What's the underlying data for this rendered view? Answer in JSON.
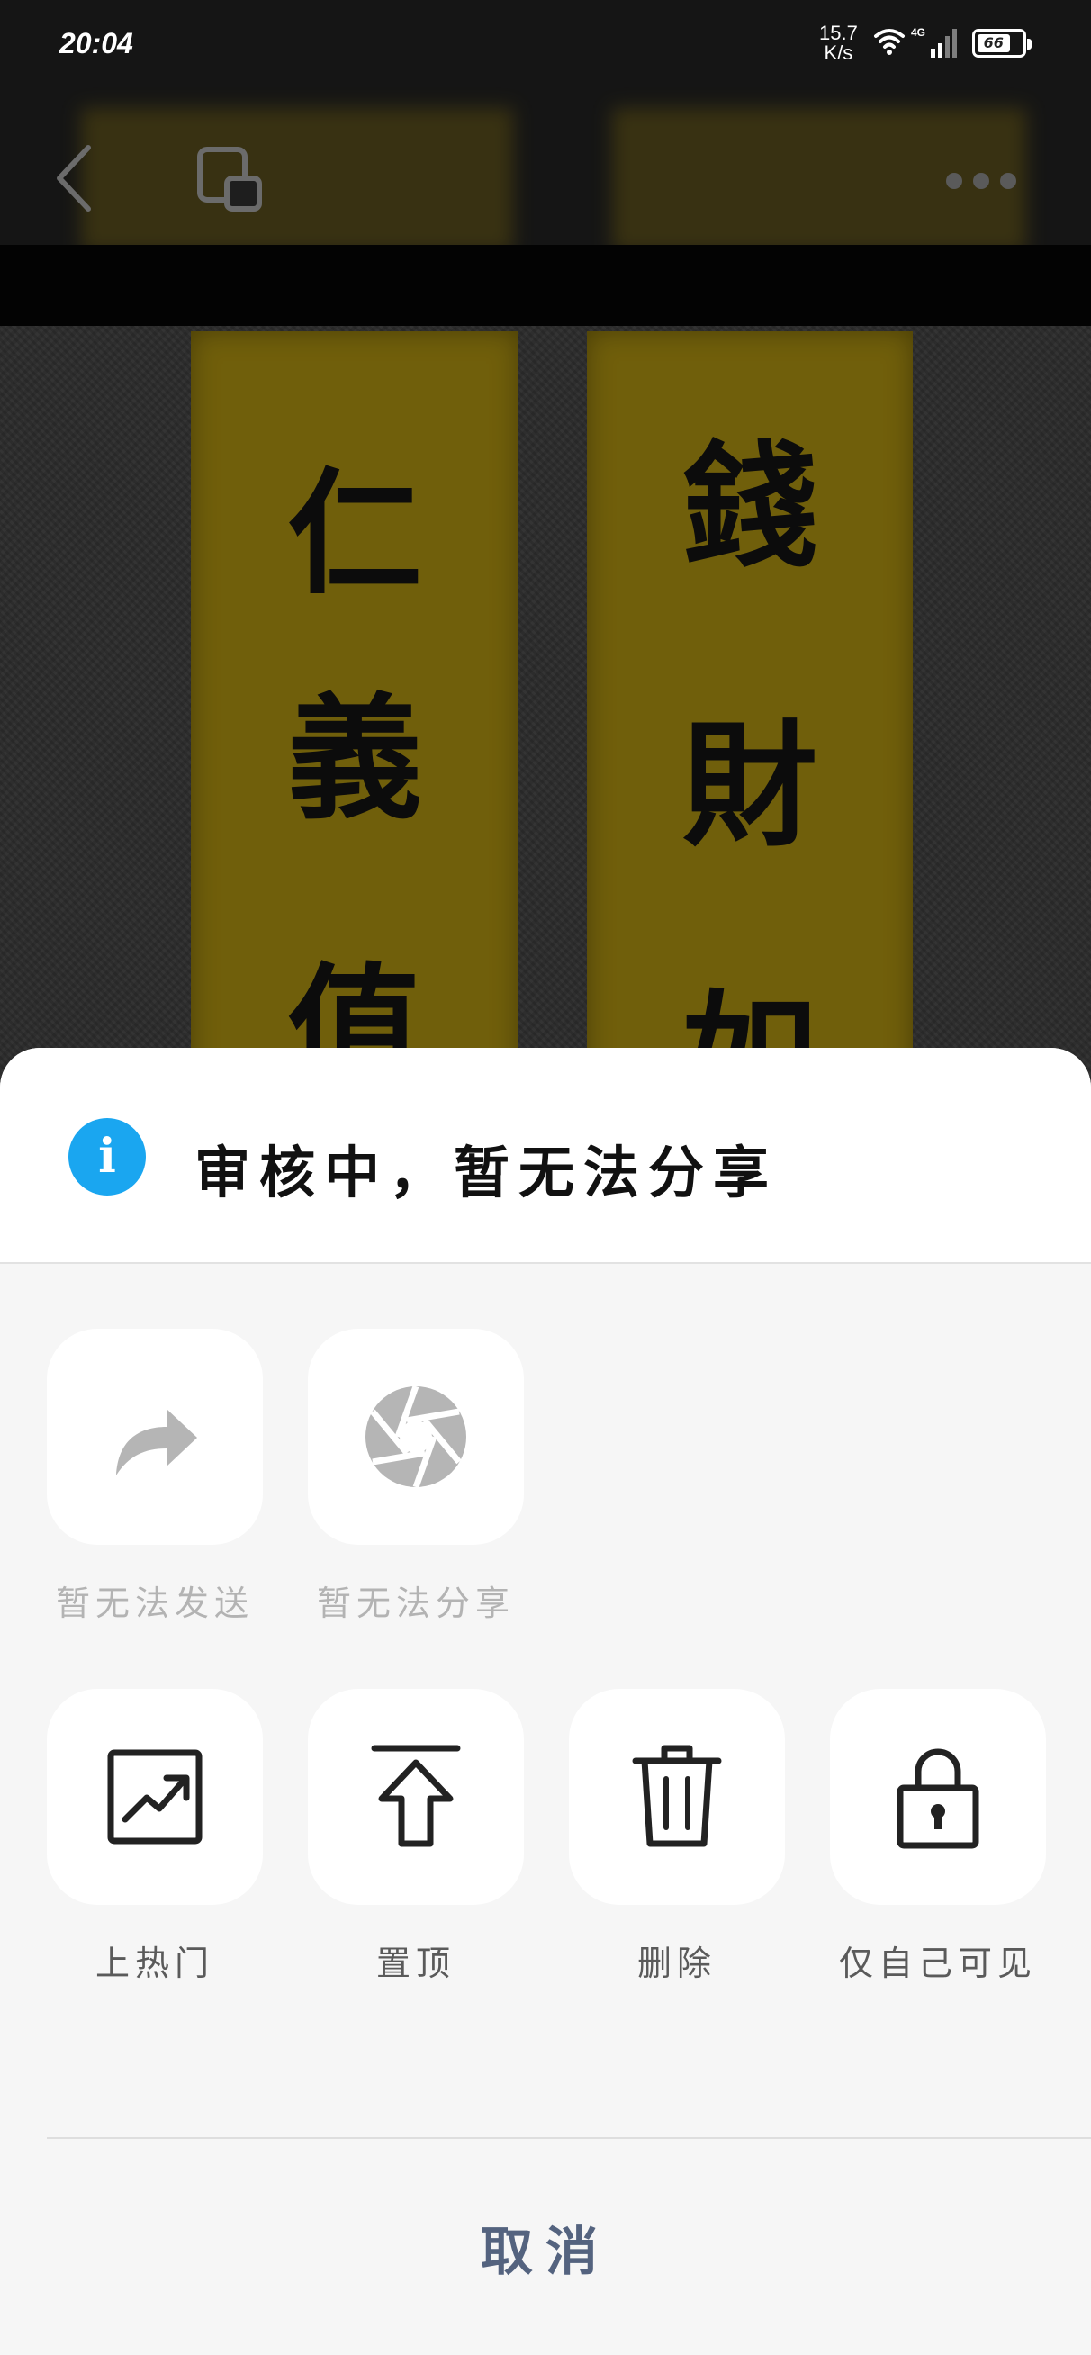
{
  "status_bar": {
    "time": "20:04",
    "net_speed_value": "15.7",
    "net_speed_unit": "K/s",
    "network_type": "4G",
    "battery": "66"
  },
  "photo": {
    "left_scroll_text": [
      "仁",
      "義",
      "值"
    ],
    "right_scroll_text": [
      "錢",
      "財",
      "如"
    ]
  },
  "notice": {
    "icon": "info-icon",
    "text": "审核中，暂无法分享"
  },
  "share_actions": [
    {
      "label": "暂无法发送",
      "icon": "forward-arrow-icon",
      "enabled": false
    },
    {
      "label": "暂无法分享",
      "icon": "aperture-icon",
      "enabled": false
    }
  ],
  "manage_actions": [
    {
      "label": "上热门",
      "icon": "trending-up-icon"
    },
    {
      "label": "置顶",
      "icon": "pin-top-icon"
    },
    {
      "label": "删除",
      "icon": "trash-icon"
    },
    {
      "label": "仅自己可见",
      "icon": "lock-icon"
    }
  ],
  "cancel_label": "取消",
  "colors": {
    "info_blue": "#1aa6f0",
    "cancel_text": "#54637f",
    "disabled_text": "#b3b3b3",
    "sheet_background": "#f6f6f6",
    "scroll_yellow": "#9c8410"
  }
}
